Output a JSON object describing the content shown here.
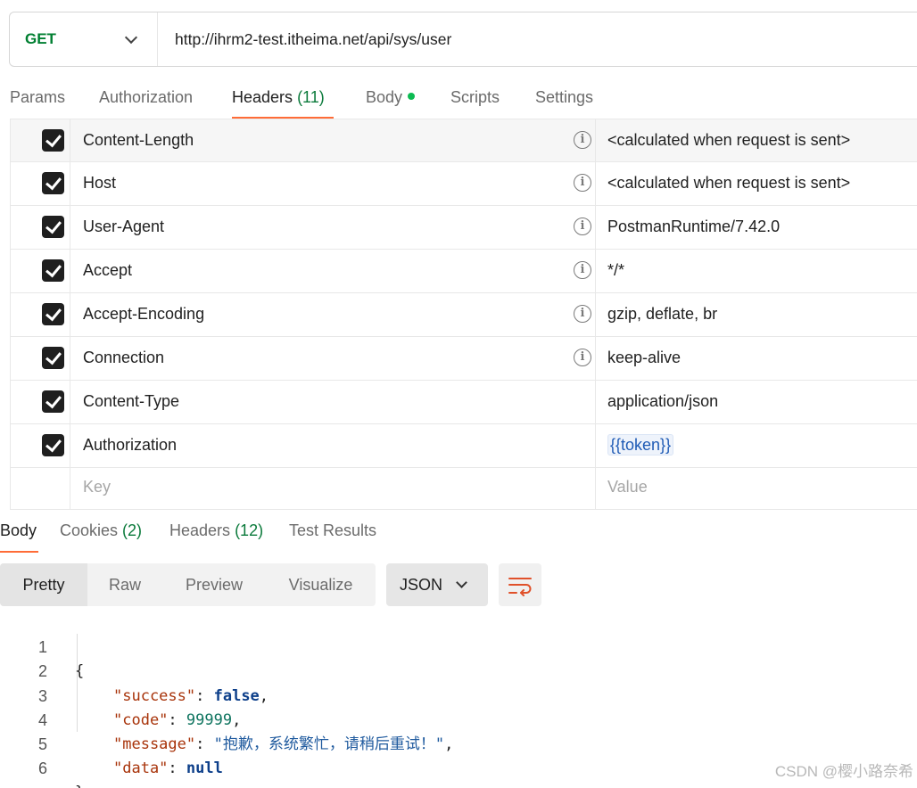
{
  "request": {
    "method": "GET",
    "url": "http://ihrm2-test.itheima.net/api/sys/user"
  },
  "request_tabs": {
    "params": "Params",
    "authorization": "Authorization",
    "headers_label": "Headers",
    "headers_count": "(11)",
    "body": "Body",
    "scripts": "Scripts",
    "settings": "Settings",
    "active": "Headers"
  },
  "headers": [
    {
      "key": "Content-Length",
      "value": "<calculated when request is sent>",
      "checked": true,
      "info": true
    },
    {
      "key": "Host",
      "value": "<calculated when request is sent>",
      "checked": true,
      "info": true
    },
    {
      "key": "User-Agent",
      "value": "PostmanRuntime/7.42.0",
      "checked": true,
      "info": true
    },
    {
      "key": "Accept",
      "value": "*/*",
      "checked": true,
      "info": true
    },
    {
      "key": "Accept-Encoding",
      "value": "gzip, deflate, br",
      "checked": true,
      "info": true
    },
    {
      "key": "Connection",
      "value": "keep-alive",
      "checked": true,
      "info": true
    },
    {
      "key": "Content-Type",
      "value": "application/json",
      "checked": true,
      "info": false
    },
    {
      "key": "Authorization",
      "value": "{{token}}",
      "checked": true,
      "info": false
    }
  ],
  "new_header": {
    "key_placeholder": "Key",
    "value_placeholder": "Value"
  },
  "response_tabs": {
    "body": "Body",
    "cookies_label": "Cookies",
    "cookies_count": "(2)",
    "headers_label": "Headers",
    "headers_count": "(12)",
    "test_results": "Test Results",
    "active": "Body"
  },
  "view_modes": [
    "Pretty",
    "Raw",
    "Preview",
    "Visualize"
  ],
  "active_view": "Pretty",
  "format": "JSON",
  "icons": {
    "method_dropdown": "chevron-down-icon",
    "info": "info-icon",
    "format_dropdown": "chevron-down-icon",
    "wrap": "wrap-lines-icon"
  },
  "colors": {
    "method": "#007f31",
    "accent": "#ff6c37",
    "count": "#0b7a3b",
    "body_dot": "#0cbb52"
  },
  "response_body": {
    "line_numbers": [
      "1",
      "2",
      "3",
      "4",
      "5",
      "6"
    ],
    "open_brace": "{",
    "close_brace": "}",
    "success_key": "\"success\"",
    "success_value": "false",
    "code_key": "\"code\"",
    "code_value": "99999",
    "message_key": "\"message\"",
    "message_value": "\"抱歉，系统繁忙，请稍后重试！\"",
    "data_key": "\"data\"",
    "data_value": "null"
  },
  "watermark": "CSDN @樱小路奈希"
}
